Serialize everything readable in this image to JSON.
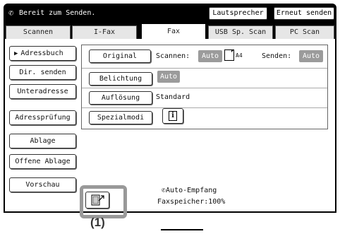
{
  "header": {
    "status_icon": "phone-receiver-icon",
    "status_text": "Bereit zum Senden.",
    "speaker_button": "Lautsprecher",
    "resend_button": "Erneut senden"
  },
  "tabs": [
    {
      "label": "Scannen"
    },
    {
      "label": "I-Fax"
    },
    {
      "label": "Fax",
      "active": true
    },
    {
      "label": "USB Sp. Scan"
    },
    {
      "label": "PC Scan"
    }
  ],
  "sidebar": {
    "items": [
      {
        "label": "Adressbuch",
        "selected": true
      },
      {
        "label": "Dir. senden"
      },
      {
        "label": "Unteradresse"
      },
      {
        "label": "Adressprüfung"
      },
      {
        "label": "Ablage"
      },
      {
        "label": "Offene Ablage"
      },
      {
        "label": "Vorschau"
      }
    ]
  },
  "settings": {
    "original_button": "Original",
    "scan_label": "Scannen:",
    "scan_value": "Auto",
    "paper_size": "A4",
    "send_label": "Senden:",
    "send_value": "Auto",
    "exposure_button": "Belichtung",
    "exposure_value": "Auto",
    "resolution_button": "Auflösung",
    "resolution_value": "Standard",
    "special_button": "Spezialmodi",
    "info_icon": "info-icon"
  },
  "status_area": {
    "auto_receive": "Auto-Empfang",
    "fax_memory": "Faxspeicher:100%"
  },
  "callout": {
    "label": "(1)"
  },
  "colors": {
    "header_bg": "#000000",
    "auto_bg": "#9b9b9b",
    "highlight": "#999999"
  }
}
